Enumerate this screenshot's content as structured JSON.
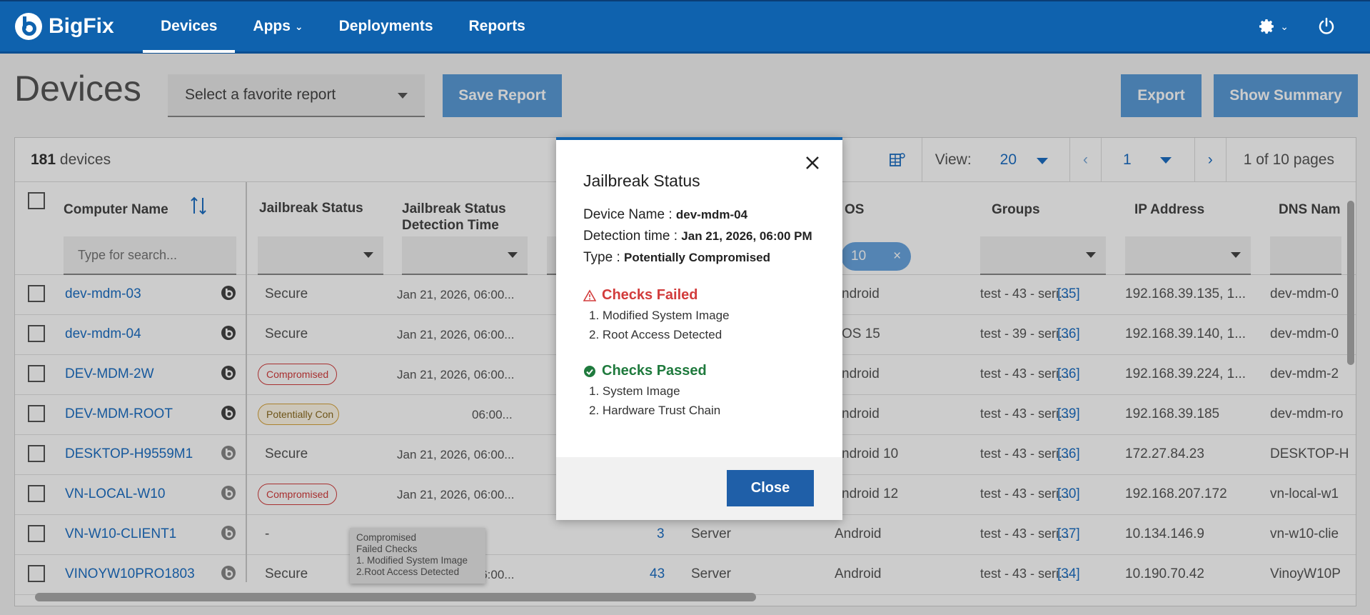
{
  "nav": {
    "brand": "BigFix",
    "items": [
      {
        "label": "Devices",
        "active": true
      },
      {
        "label": "Apps",
        "dropdown": true
      },
      {
        "label": "Deployments"
      },
      {
        "label": "Reports"
      }
    ]
  },
  "header": {
    "title": "Devices",
    "report_select_placeholder": "Select a favorite report",
    "save_report": "Save Report",
    "export": "Export",
    "show_summary": "Show Summary"
  },
  "toolbar": {
    "device_count": "181",
    "device_label": "devices",
    "view_label": "View:",
    "view_value": "20",
    "page_value": "1",
    "page_info": "1 of 10 pages"
  },
  "columns": {
    "computer_name": "Computer Name",
    "jailbreak_status": "Jailbreak Status",
    "detection_time_1": "Jailbreak Status",
    "detection_time_2": "Detection Time",
    "os": "OS",
    "groups": "Groups",
    "ip_address": "IP Address",
    "dns_name": "DNS Nam",
    "search_placeholder": "Type for search...",
    "os_filter_chip": "10"
  },
  "rows": [
    {
      "name": "dev-mdm-03",
      "status": "Secure",
      "status_type": "text",
      "time": "Jan 21, 2026, 06:00...",
      "num": "",
      "type": "",
      "os": "ndroid",
      "groups": "test - 43 - seri...",
      "gcount": "[35]",
      "ip": "192.168.39.135, 1...",
      "dns": "dev-mdm-0"
    },
    {
      "name": "dev-mdm-04",
      "status": "Secure",
      "status_type": "text",
      "time": "Jan 21, 2026, 06:00...",
      "num": "",
      "type": "",
      "os": "OS 15",
      "groups": "test - 39 - seri...",
      "gcount": "[36]",
      "ip": "192.168.39.140, 1...",
      "dns": "dev-mdm-0"
    },
    {
      "name": "DEV-MDM-2W",
      "status": "Compromised",
      "status_type": "comp",
      "time": "Jan 21, 2026, 06:00...",
      "num": "",
      "type": "",
      "os": "ndroid",
      "groups": "test - 43 - seri...",
      "gcount": "[36]",
      "ip": "192.168.39.224, 1...",
      "dns": "dev-mdm-2"
    },
    {
      "name": "DEV-MDM-ROOT",
      "status": "Potentially Con",
      "status_type": "pot",
      "time": "06:00...",
      "num": "",
      "type": "",
      "os": "ndroid",
      "groups": "test - 43 - seri...",
      "gcount": "[39]",
      "ip": "192.168.39.185",
      "dns": "dev-mdm-ro"
    },
    {
      "name": "DESKTOP-H9559M1",
      "status": "Secure",
      "status_type": "text",
      "time": "Jan 21, 2026, 06:00...",
      "num": "",
      "type": "",
      "os": "ndroid 10",
      "groups": "test - 43 - seri...",
      "gcount": "[36]",
      "ip": "172.27.84.23",
      "dns": "DESKTOP-H"
    },
    {
      "name": "VN-LOCAL-W10",
      "status": "Compromised",
      "status_type": "comp",
      "time": "Jan 21, 2026, 06:00...",
      "num": "",
      "type": "",
      "os": "ndroid 12",
      "groups": "test - 43 - seri...",
      "gcount": "[30]",
      "ip": "192.168.207.172",
      "dns": "vn-local-w1"
    },
    {
      "name": "VN-W10-CLIENT1",
      "status": "-",
      "status_type": "text",
      "time": "-",
      "num": "3",
      "type": "Server",
      "os": "Android",
      "groups": "test - 43 - seri...",
      "gcount": "[37]",
      "ip": "10.134.146.9",
      "dns": "vn-w10-clie"
    },
    {
      "name": "VINOYW10PRO1803",
      "status": "Secure",
      "status_type": "text",
      "time": "Jan 21, 2026, 06:00...",
      "num": "43",
      "type": "Server",
      "os": "Android",
      "groups": "test - 43 - seri...",
      "gcount": "[34]",
      "ip": "10.190.70.42",
      "dns": "VinoyW10P"
    }
  ],
  "tooltip": {
    "line1": "Compromised",
    "line2": "Failed Checks",
    "line3": "1. Modified System Image",
    "line4": "2.Root Access Detected"
  },
  "modal": {
    "title": "Jailbreak Status",
    "device_label": "Device Name :",
    "device_value": "dev-mdm-04",
    "time_label": "Detection time :",
    "time_value": "Jan 21, 2026, 06:00 PM",
    "type_label": "Type :",
    "type_value": "Potentially Compromised",
    "failed_title": "Checks Failed",
    "failed_items": [
      "1. Modified System Image",
      "2. Root Access Detected"
    ],
    "passed_title": "Checks Passed",
    "passed_items": [
      "1. System Image",
      "2. Hardware Trust Chain"
    ],
    "close_button": "Close"
  }
}
